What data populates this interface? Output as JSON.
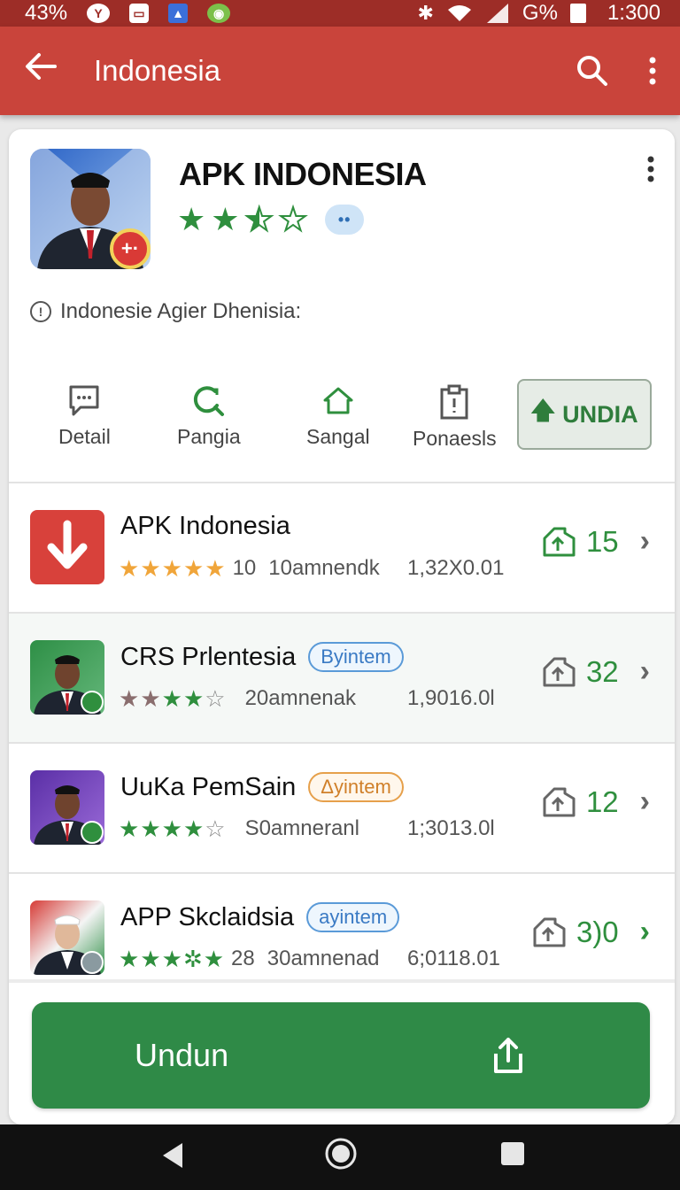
{
  "status_bar": {
    "battery_left": "43%",
    "battery_right": "G%",
    "time": "1:300"
  },
  "app_bar": {
    "title": "Indonesia"
  },
  "hero": {
    "title": "APK INDONESIA",
    "rating": 2.5,
    "info_text": "Indonesie Agier Dhenisia:"
  },
  "actions": [
    {
      "label": "Detail",
      "icon": "chat-icon"
    },
    {
      "label": "Pangia",
      "icon": "search-refresh-icon"
    },
    {
      "label": "Sangal",
      "icon": "home-icon"
    },
    {
      "label": "Ponaesls",
      "icon": "clipboard-icon"
    }
  ],
  "install_button": {
    "label": "UNDIA"
  },
  "list": [
    {
      "name": "APK Indonesia",
      "tag": "",
      "rating_text": "10",
      "subtitle": "10amnendk",
      "size": "1,32X0.01",
      "count": "15",
      "stars": 5,
      "star_color": "#f0a53a",
      "thumb": "download-red"
    },
    {
      "name": "CRS Prlentesia",
      "tag": "Byintem",
      "tag_style": "blue",
      "rating_text": "",
      "subtitle": "20amnenak",
      "size": "1,9016.0l",
      "count": "32",
      "stars": 4,
      "star_color": "#8a6e6e",
      "thumb": "green"
    },
    {
      "name": "UuKa PemSain",
      "tag": "Δyintem",
      "tag_style": "orange",
      "rating_text": "",
      "subtitle": "S0amneranl",
      "size": "1;3013.0l",
      "count": "12",
      "stars": 4,
      "star_color": "#2f8f3e",
      "thumb": "purple"
    },
    {
      "name": "APP Skclaidsia",
      "tag": "ayintem",
      "tag_style": "blue",
      "rating_text": "28",
      "subtitle": "30amnenad",
      "size": "6;0118.01",
      "count": "3)0",
      "stars": 5,
      "star_color": "#2f8f3e",
      "thumb": "red-white"
    }
  ],
  "bottom_button": {
    "label": "Undun"
  },
  "colors": {
    "primary_red": "#c9443b",
    "status_red": "#9d2d27",
    "accent_green": "#2f8a47",
    "star_green": "#2f8f3e"
  }
}
